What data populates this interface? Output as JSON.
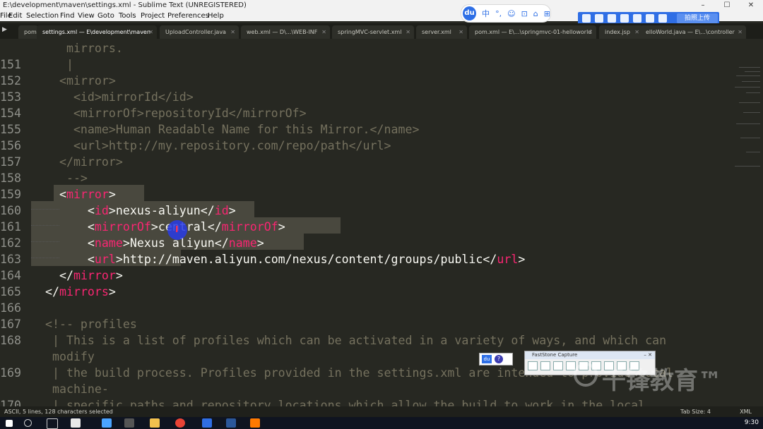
{
  "window": {
    "title": "E:\\development\\maven\\settings.xml - Sublime Text (UNREGISTERED)",
    "controls": [
      "–",
      "☐",
      "✕"
    ]
  },
  "menu": [
    "File",
    "Edit",
    "Selection",
    "Find",
    "View",
    "Goto",
    "Tools",
    "Project",
    "Preferences",
    "Help"
  ],
  "du_widget": {
    "logo": "du",
    "items": [
      "中",
      "°,",
      "☺",
      "⊡",
      "⌂",
      "⊞"
    ]
  },
  "upload_toolbar": {
    "label": "拍照上传"
  },
  "tabs": [
    {
      "label": "pom",
      "active": false
    },
    {
      "label": "settings.xml — E\\development\\maven",
      "active": true
    },
    {
      "label": "UploadController.java",
      "active": false
    },
    {
      "label": "web.xml — D\\...\\WEB-INF",
      "active": false
    },
    {
      "label": "springMVC-servlet.xml",
      "active": false
    },
    {
      "label": "server.xml",
      "active": false
    },
    {
      "label": "pom.xml — E\\...\\springmvc-01-helloworld",
      "active": false
    },
    {
      "label": "index.jsp",
      "active": false
    },
    {
      "label": "elloWorld.java — E\\...\\controller",
      "active": false
    }
  ],
  "editor": {
    "lines": [
      {
        "num": "",
        "parts": [
          [
            "c-com",
            "     mirrors."
          ]
        ]
      },
      {
        "num": "151",
        "parts": [
          [
            "c-com",
            "     |"
          ]
        ]
      },
      {
        "num": "152",
        "parts": [
          [
            "c-com",
            "    <mirror>"
          ]
        ]
      },
      {
        "num": "153",
        "parts": [
          [
            "c-com",
            "      <id>mirrorId</id>"
          ]
        ]
      },
      {
        "num": "154",
        "parts": [
          [
            "c-com",
            "      <mirrorOf>repositoryId</mirrorOf>"
          ]
        ]
      },
      {
        "num": "155",
        "parts": [
          [
            "c-com",
            "      <name>Human Readable Name for this Mirror.</name>"
          ]
        ]
      },
      {
        "num": "156",
        "parts": [
          [
            "c-com",
            "      <url>http://my.repository.com/repo/path</url>"
          ]
        ]
      },
      {
        "num": "157",
        "parts": [
          [
            "c-com",
            "    </mirror>"
          ]
        ]
      },
      {
        "num": "158",
        "parts": [
          [
            "c-com",
            "     -->"
          ]
        ]
      },
      {
        "num": "159",
        "parts": [
          [
            "c-txt",
            "    <"
          ],
          [
            "c-tag",
            "mirror"
          ],
          [
            "c-txt",
            ">"
          ]
        ]
      },
      {
        "num": "160",
        "parts": [
          [
            "c-txt",
            "        <"
          ],
          [
            "c-tag",
            "id"
          ],
          [
            "c-txt",
            ">nexus-aliyun</"
          ],
          [
            "c-tag",
            "id"
          ],
          [
            "c-txt",
            ">"
          ]
        ]
      },
      {
        "num": "161",
        "parts": [
          [
            "c-txt",
            "        <"
          ],
          [
            "c-tag",
            "mirrorOf"
          ],
          [
            "c-txt",
            ">central</"
          ],
          [
            "c-tag",
            "mirrorOf"
          ],
          [
            "c-txt",
            ">"
          ]
        ]
      },
      {
        "num": "162",
        "parts": [
          [
            "c-txt",
            "        <"
          ],
          [
            "c-tag",
            "name"
          ],
          [
            "c-txt",
            ">Nexus aliyun</"
          ],
          [
            "c-tag",
            "name"
          ],
          [
            "c-txt",
            ">"
          ]
        ]
      },
      {
        "num": "163",
        "parts": [
          [
            "c-txt",
            "        <"
          ],
          [
            "c-tag",
            "url"
          ],
          [
            "c-txt",
            ">http://maven.aliyun.com/nexus/content/groups/public</"
          ],
          [
            "c-tag",
            "url"
          ],
          [
            "c-txt",
            ">"
          ]
        ]
      },
      {
        "num": "164",
        "parts": [
          [
            "c-txt",
            "    </"
          ],
          [
            "c-tag",
            "mirror"
          ],
          [
            "c-txt",
            ">"
          ]
        ]
      },
      {
        "num": "165",
        "parts": [
          [
            "c-txt",
            "  </"
          ],
          [
            "c-tag",
            "mirrors"
          ],
          [
            "c-txt",
            ">"
          ]
        ]
      },
      {
        "num": "166",
        "parts": [
          [
            "c-txt",
            ""
          ]
        ]
      },
      {
        "num": "167",
        "parts": [
          [
            "c-com",
            "  <!-- profiles"
          ]
        ]
      },
      {
        "num": "168",
        "parts": [
          [
            "c-com",
            "   | This is a list of profiles which can be activated in a variety of ways, and which can"
          ]
        ]
      },
      {
        "num": "",
        "parts": [
          [
            "c-com",
            "   modify"
          ]
        ]
      },
      {
        "num": "169",
        "parts": [
          [
            "c-com",
            "   | the build process. Profiles provided in the settings.xml are intended to provide local"
          ]
        ]
      },
      {
        "num": "",
        "parts": [
          [
            "c-com",
            "   machine-"
          ]
        ]
      },
      {
        "num": "170",
        "parts": [
          [
            "c-com",
            "   | specific paths and repository locations which allow the build to work in the local"
          ]
        ]
      }
    ],
    "selected_rows": [
      9,
      10,
      11,
      12,
      13
    ]
  },
  "faststone": {
    "title": "FastStone Capture"
  },
  "watermark": {
    "text": "千锋教育™"
  },
  "status": {
    "left": "ASCII, 5 lines, 128 characters selected",
    "tab_size": "Tab Size: 4",
    "syntax": "XML"
  },
  "taskbar": {
    "time": "9:30"
  },
  "colors": {
    "background": "#272822",
    "tag": "#f92672",
    "comment": "#75715e",
    "text": "#f8f8f2",
    "selection": "#49483e"
  }
}
